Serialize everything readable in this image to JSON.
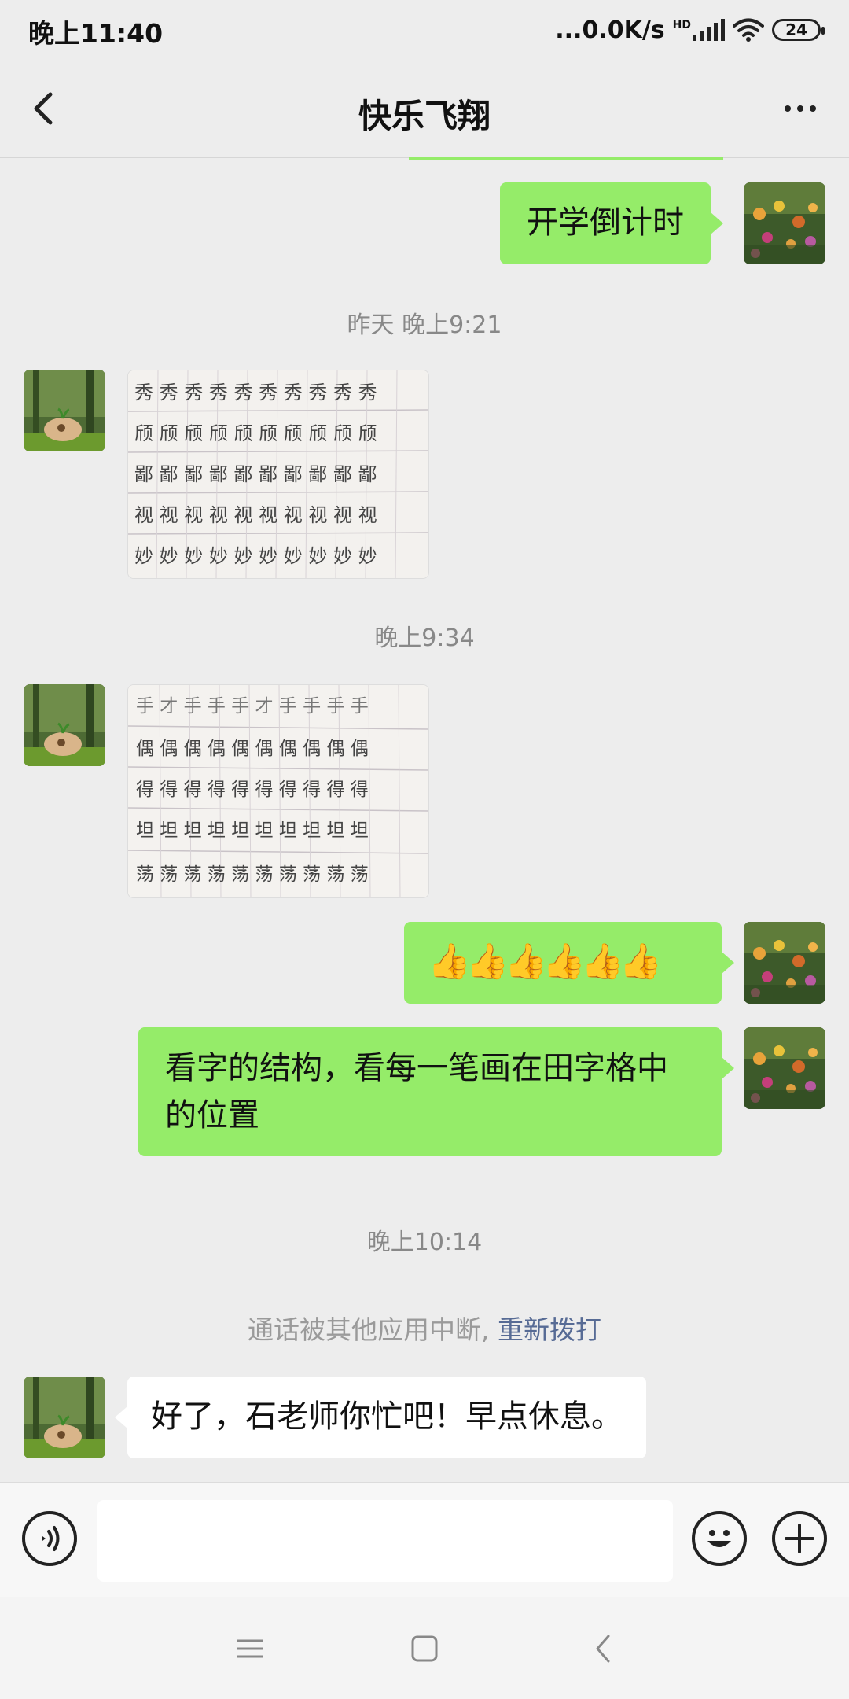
{
  "status_bar": {
    "time": "晚上11:40",
    "network_speed": "...0.0K/s",
    "hd_label": "HD",
    "battery": "24"
  },
  "header": {
    "title": "快乐飞翔",
    "back_icon": "chevron-left-icon",
    "more_icon": "more-dots-icon"
  },
  "messages": [
    {
      "side": "me",
      "type": "text",
      "text": "开学倒计时"
    },
    {
      "type": "timestamp",
      "text": "昨天 晚上9:21"
    },
    {
      "side": "other",
      "type": "image",
      "description": "handwriting-practice-sheet-1",
      "rows": [
        "秀",
        "颀",
        "鄙",
        "视",
        "妙"
      ]
    },
    {
      "type": "timestamp",
      "text": "晚上9:34"
    },
    {
      "side": "other",
      "type": "image",
      "description": "handwriting-practice-sheet-2",
      "rows": [
        "手",
        "偶",
        "得",
        "坦",
        "荡"
      ]
    },
    {
      "side": "me",
      "type": "text",
      "text": "👍👍👍👍👍👍"
    },
    {
      "side": "me",
      "type": "text",
      "text": "看字的结构，看每一笔画在田字格中的位置"
    },
    {
      "type": "timestamp",
      "text": "晚上10:14"
    },
    {
      "type": "system",
      "text": "通话被其他应用中断,",
      "link": "重新拨打"
    },
    {
      "side": "other",
      "type": "text",
      "text": "好了，石老师你忙吧！早点休息。"
    }
  ],
  "input_bar": {
    "voice_icon": "voice-icon",
    "emoji_icon": "emoji-icon",
    "plus_icon": "plus-icon",
    "placeholder": ""
  },
  "nav_bar": {
    "menu_icon": "menu-icon",
    "home_icon": "home-square-icon",
    "back_icon": "back-triangle-icon"
  },
  "colors": {
    "my_bubble": "#95ec69",
    "other_bubble": "#ffffff",
    "background": "#ededed",
    "link": "#576b95"
  }
}
